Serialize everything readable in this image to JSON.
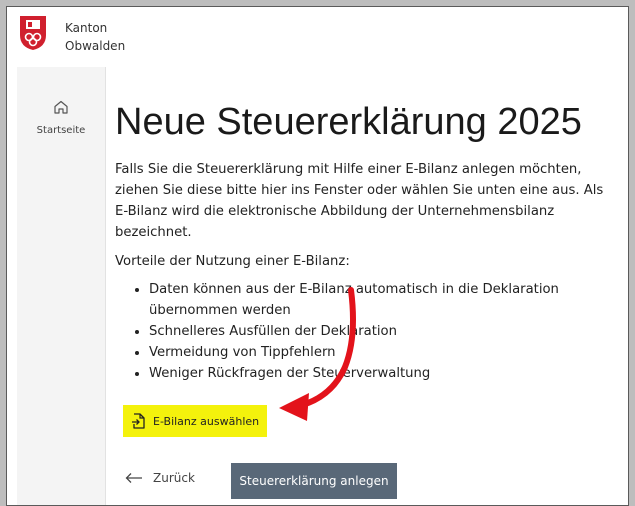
{
  "brand": {
    "line1": "Kanton",
    "line2": "Obwalden"
  },
  "sidebar": {
    "items": [
      {
        "label": "Startseite",
        "icon": "home-icon"
      }
    ]
  },
  "main": {
    "title": "Neue Steuererklärung 2025",
    "intro": "Falls Sie die Steuererklärung mit Hilfe einer E-Bilanz anlegen möchten, ziehen Sie diese bitte hier ins Fenster oder wählen Sie unten eine aus. Als E-Bilanz wird die elektronische Abbildung der Unternehmensbilanz bezeichnet.",
    "advantages_heading": "Vorteile der Nutzung einer E-Bilanz:",
    "advantages": [
      "Daten können aus der E-Bilanz automatisch in die Deklaration übernommen werden",
      "Schnelleres Ausfüllen der Deklaration",
      "Vermeidung von Tippfehlern",
      "Weniger Rückfragen der Steuerverwaltung"
    ],
    "ebilanz_button": "E-Bilanz auswählen",
    "back_button": "Zurück",
    "primary_button": "Steuererklärung anlegen"
  },
  "colors": {
    "highlight": "#f4f20c",
    "annotation_arrow": "#e3131b",
    "primary_button_bg": "#596878",
    "crest_red": "#d0202e"
  },
  "icons": [
    "canton-crest-icon",
    "home-icon",
    "file-import-icon",
    "arrow-left-icon"
  ]
}
